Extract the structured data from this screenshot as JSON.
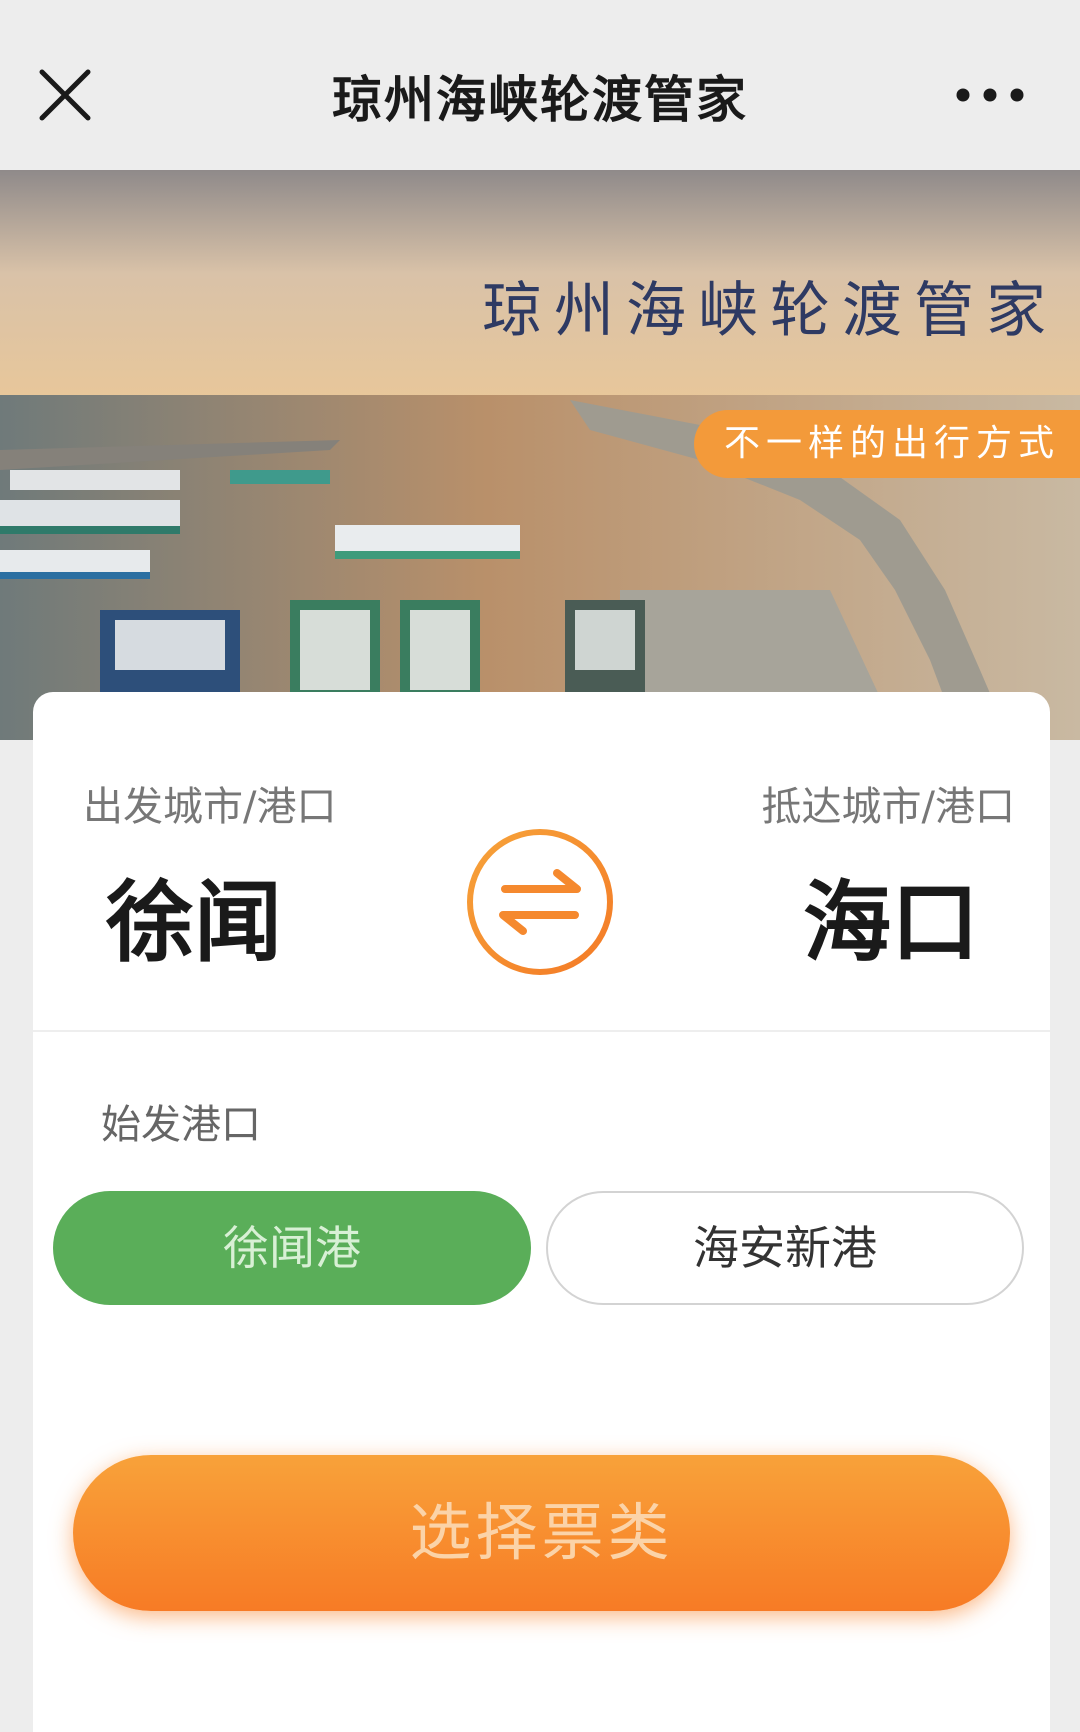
{
  "header": {
    "title": "琼州海峡轮渡管家",
    "close_icon": "close-icon",
    "more_icon": "more-dots-icon"
  },
  "banner": {
    "title": "琼州海峡轮渡管家",
    "tag": "不一样的出行方式"
  },
  "route": {
    "from_label": "出发城市/港口",
    "to_label": "抵达城市/港口",
    "from_city": "徐闻",
    "to_city": "海口",
    "swap_icon": "swap-arrows-icon"
  },
  "departure_port": {
    "label": "始发港口",
    "options": [
      {
        "label": "徐闻港",
        "selected": true
      },
      {
        "label": "海安新港",
        "selected": false
      }
    ]
  },
  "action": {
    "select_ticket_label": "选择票类"
  },
  "colors": {
    "accent_orange": "#f77b25",
    "selected_green": "#5aae59",
    "background": "#ededed"
  }
}
